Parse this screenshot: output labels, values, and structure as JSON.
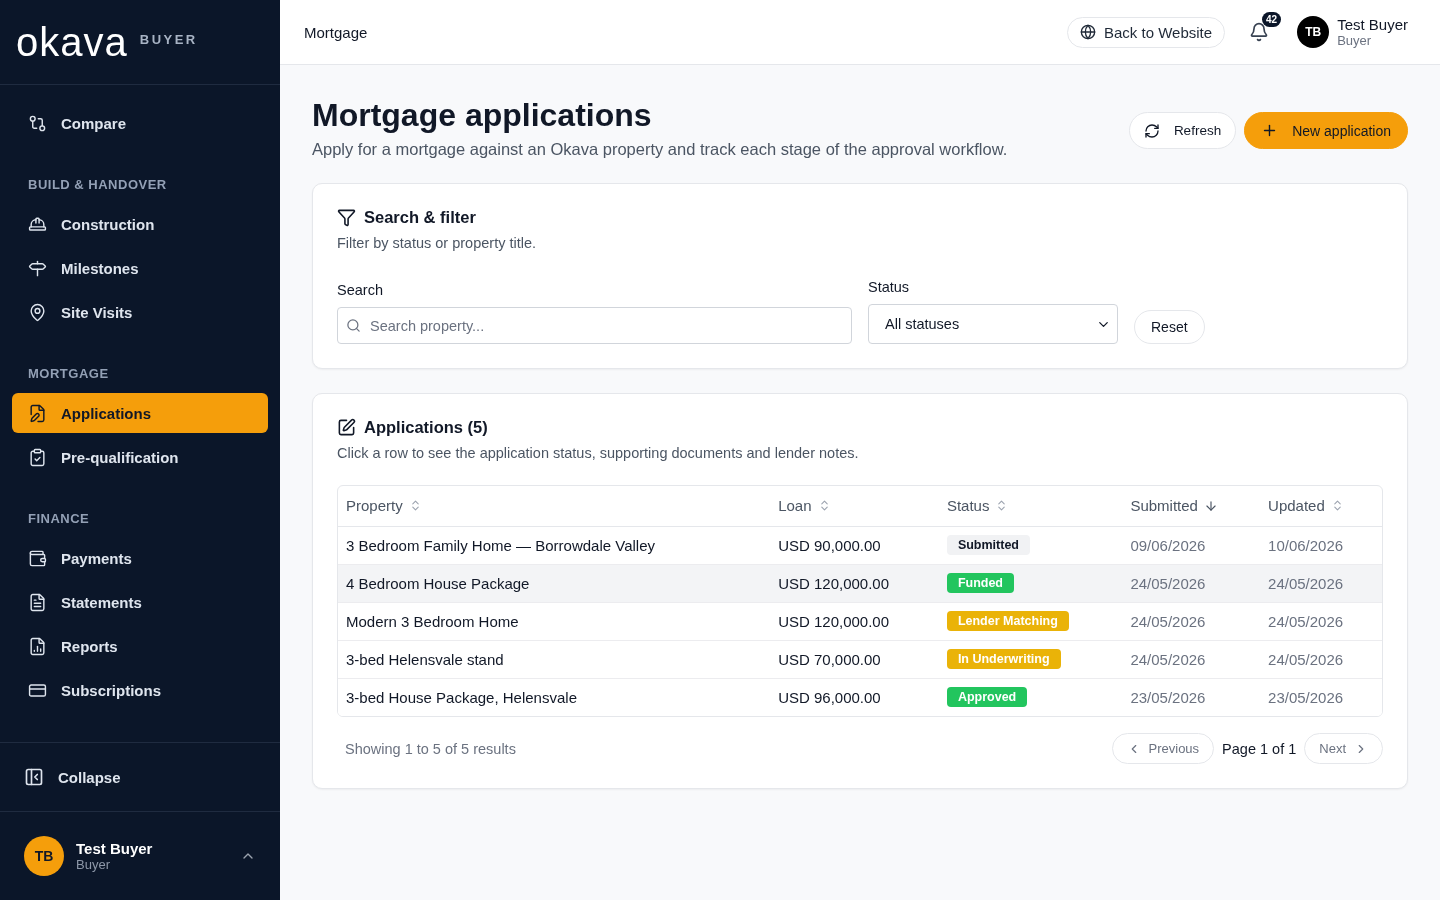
{
  "sidebar": {
    "logo": "okava",
    "role_tag": "BUYER",
    "sections": [
      {
        "items": [
          {
            "label": "Compare",
            "selected": false
          }
        ]
      },
      {
        "heading": "BUILD & HANDOVER",
        "items": [
          {
            "label": "Construction",
            "selected": false
          },
          {
            "label": "Milestones",
            "selected": false
          },
          {
            "label": "Site Visits",
            "selected": false
          }
        ]
      },
      {
        "heading": "MORTGAGE",
        "items": [
          {
            "label": "Applications",
            "selected": true
          },
          {
            "label": "Pre-qualification",
            "selected": false
          }
        ]
      },
      {
        "heading": "FINANCE",
        "items": [
          {
            "label": "Payments",
            "selected": false
          },
          {
            "label": "Statements",
            "selected": false
          },
          {
            "label": "Reports",
            "selected": false
          },
          {
            "label": "Subscriptions",
            "selected": false
          }
        ]
      }
    ],
    "collapse": "Collapse",
    "user": {
      "initials": "TB",
      "name": "Test Buyer",
      "role": "Buyer"
    }
  },
  "header": {
    "breadcrumb": "Mortgage",
    "back_button": "Back to Website",
    "notifications": "42",
    "user": {
      "initials": "TB",
      "name": "Test Buyer",
      "role": "Buyer"
    }
  },
  "page": {
    "title": "Mortgage applications",
    "subtitle": "Apply for a mortgage against an Okava property and track each stage of the approval workflow.",
    "refresh": "Refresh",
    "new_button": "New application"
  },
  "filter": {
    "title": "Search & filter",
    "subtitle": "Filter by status or property title.",
    "search_label": "Search",
    "search_placeholder": "Search property...",
    "status_label": "Status",
    "status_value": "All statuses",
    "reset": "Reset"
  },
  "applications": {
    "title": "Applications (5)",
    "subtitle": "Click a row to see the application status, supporting documents and lender notes.",
    "columns": [
      {
        "label": "Property",
        "sorted": false
      },
      {
        "label": "Loan",
        "sorted": false
      },
      {
        "label": "Status",
        "sorted": false
      },
      {
        "label": "Submitted",
        "sorted": true
      },
      {
        "label": "Updated",
        "sorted": false
      }
    ],
    "rows": [
      {
        "property": "3 Bedroom Family Home — Borrowdale Valley",
        "loan": "USD 90,000.00",
        "status": "Submitted",
        "color": "#f1f2f4",
        "submitted": "09/06/2026",
        "updated": "10/06/2026",
        "selected": false
      },
      {
        "property": "4 Bedroom House Package",
        "loan": "USD 120,000.00",
        "status": "Funded",
        "color": "#22c55e",
        "submitted": "24/05/2026",
        "updated": "24/05/2026",
        "selected": true
      },
      {
        "property": "Modern 3 Bedroom Home",
        "loan": "USD 120,000.00",
        "status": "Lender Matching",
        "color": "#eab308",
        "submitted": "24/05/2026",
        "updated": "24/05/2026",
        "selected": false
      },
      {
        "property": "3-bed Helensvale stand",
        "loan": "USD 70,000.00",
        "status": "In Underwriting",
        "color": "#eab308",
        "submitted": "24/05/2026",
        "updated": "24/05/2026",
        "selected": false
      },
      {
        "property": "3-bed House Package, Helensvale",
        "loan": "USD 96,000.00",
        "status": "Approved",
        "color": "#22c55e",
        "submitted": "23/05/2026",
        "updated": "23/05/2026",
        "selected": false
      }
    ],
    "summary": "Showing 1 to 5 of 5 results",
    "previous": "Previous",
    "page_info": "Page 1 of 1",
    "next": "Next"
  }
}
